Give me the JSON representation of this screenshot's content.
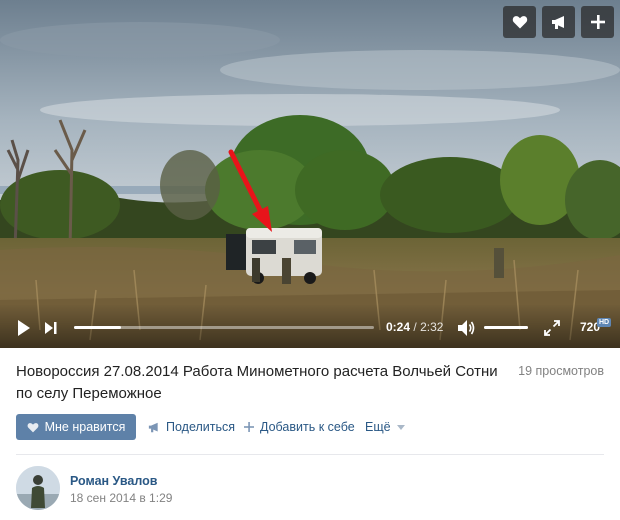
{
  "player": {
    "current_time": "0:24",
    "time_separator": "/",
    "duration": "2:32",
    "progress_fraction": 0.158,
    "volume_fraction": 1.0,
    "quality_label": "720",
    "hd_badge": "HD",
    "top_buttons": [
      "heart-icon",
      "megaphone-icon",
      "plus-icon"
    ],
    "icons": {
      "play": "play-icon",
      "next": "next-icon",
      "volume": "volume-icon",
      "fullscreen": "fullscreen-icon"
    }
  },
  "video": {
    "title": "Новороссия 27.08.2014 Работа Минометного расчета Волчьей Сотни по селу Переможное",
    "views": "19 просмотров"
  },
  "actions": {
    "like_label": "Мне нравится",
    "share_label": "Поделиться",
    "add_label": "Добавить к себе",
    "more_label": "Ещё"
  },
  "author": {
    "name": "Роман Увалов",
    "date": "18 сен 2014 в 1:29"
  },
  "colors": {
    "accent": "#5e81a8",
    "link": "#2a5885",
    "muted": "#828282",
    "annotation_arrow": "#e8141a"
  }
}
